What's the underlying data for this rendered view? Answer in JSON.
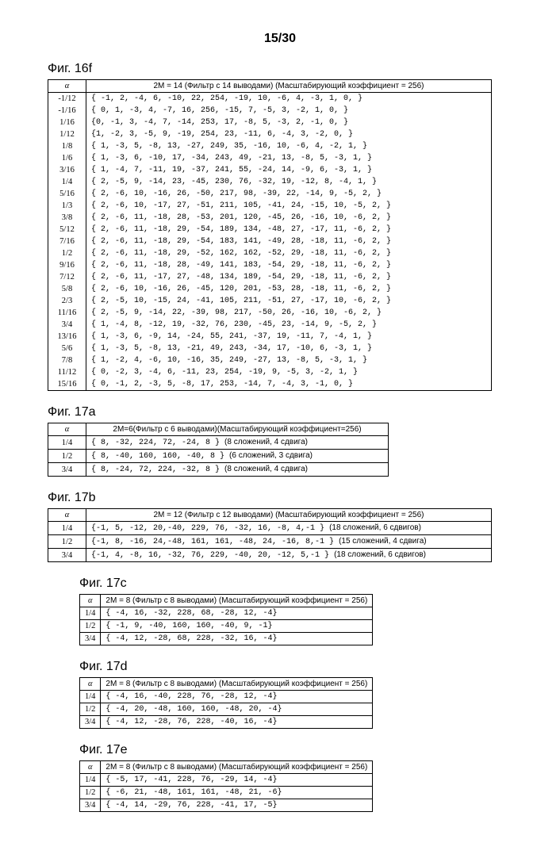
{
  "page_number": "15/30",
  "fig16f": {
    "label": "Фиг. 16f",
    "alpha_header": "α",
    "header": "2М = 14 (Фильтр с 14 выводами) (Масштабирующий коэффициент = 256)",
    "rows": [
      {
        "a": "-1/12",
        "c": "{ -1, 2, -4, 6, -10, 22, 254, -19, 10, -6, 4, -3, 1, 0, }"
      },
      {
        "a": "-1/16",
        "c": "{ 0, 1, -3, 4, -7, 16, 256, -15, 7, -5, 3, -2, 1, 0, }"
      },
      {
        "a": "1/16",
        "c": "{0, -1, 3, -4, 7, -14, 253, 17, -8, 5, -3, 2, -1, 0, }"
      },
      {
        "a": "1/12",
        "c": "{1, -2, 3, -5, 9, -19, 254, 23, -11, 6, -4, 3, -2, 0, }"
      },
      {
        "a": "1/8",
        "c": "{ 1, -3, 5, -8, 13, -27, 249, 35, -16, 10, -6, 4, -2, 1, }"
      },
      {
        "a": "1/6",
        "c": "{ 1, -3, 6, -10, 17, -34, 243, 49, -21, 13, -8, 5, -3, 1, }"
      },
      {
        "a": "3/16",
        "c": "{ 1, -4, 7, -11, 19, -37, 241, 55, -24, 14, -9, 6, -3, 1, }"
      },
      {
        "a": "1/4",
        "c": "{ 2, -5, 9, -14, 23, -45, 230, 76, -32, 19, -12, 8, -4, 1, }"
      },
      {
        "a": "5/16",
        "c": "{ 2, -6, 10, -16, 26, -50, 217, 98, -39, 22, -14, 9, -5, 2, }"
      },
      {
        "a": "1/3",
        "c": "{ 2, -6, 10, -17, 27, -51, 211, 105, -41, 24, -15, 10, -5, 2, }"
      },
      {
        "a": "3/8",
        "c": "{ 2, -6, 11, -18, 28, -53, 201, 120, -45, 26, -16, 10, -6, 2, }"
      },
      {
        "a": "5/12",
        "c": "{ 2, -6, 11, -18, 29, -54, 189, 134, -48, 27, -17, 11, -6, 2, }"
      },
      {
        "a": "7/16",
        "c": "{ 2, -6, 11, -18, 29, -54, 183, 141, -49, 28, -18, 11, -6, 2, }"
      },
      {
        "a": "1/2",
        "c": "{ 2, -6, 11, -18, 29, -52, 162, 162, -52, 29, -18, 11, -6, 2, }"
      },
      {
        "a": "9/16",
        "c": "{ 2, -6, 11, -18, 28, -49, 141, 183, -54, 29, -18, 11, -6, 2, }"
      },
      {
        "a": "7/12",
        "c": "{ 2, -6, 11, -17, 27, -48, 134, 189, -54, 29, -18, 11, -6, 2, }"
      },
      {
        "a": "5/8",
        "c": "{ 2, -6, 10, -16, 26, -45, 120, 201, -53, 28, -18, 11, -6, 2, }"
      },
      {
        "a": "2/3",
        "c": "{ 2, -5, 10, -15, 24, -41, 105, 211, -51, 27, -17, 10, -6, 2, }"
      },
      {
        "a": "11/16",
        "c": "{ 2, -5, 9, -14, 22, -39, 98, 217, -50, 26, -16, 10, -6, 2, }"
      },
      {
        "a": "3/4",
        "c": "{ 1, -4, 8, -12, 19, -32, 76, 230, -45, 23, -14, 9, -5, 2, }"
      },
      {
        "a": "13/16",
        "c": "{ 1, -3, 6, -9, 14, -24, 55, 241, -37, 19, -11, 7, -4, 1, }"
      },
      {
        "a": "5/6",
        "c": "{ 1, -3, 5, -8, 13, -21, 49, 243, -34, 17, -10, 6, -3, 1, }"
      },
      {
        "a": "7/8",
        "c": "{ 1, -2, 4, -6, 10, -16, 35, 249, -27, 13, -8, 5, -3, 1, }"
      },
      {
        "a": "11/12",
        "c": "{ 0, -2, 3, -4, 6, -11, 23, 254, -19, 9, -5, 3, -2, 1, }"
      },
      {
        "a": "15/16",
        "c": "{ 0, -1, 2, -3, 5, -8, 17, 253, -14, 7, -4, 3, -1, 0, }"
      }
    ]
  },
  "fig17a": {
    "label": "Фиг. 17a",
    "alpha_header": "α",
    "header": "2М=6(Фильтр с 6 выводами)(Масштабирующий коэффициент=256)",
    "rows": [
      {
        "a": "1/4",
        "c": "{  8, -32, 224,  72, -24,  8 }",
        "n": "(8 сложений, 4 сдвига)"
      },
      {
        "a": "1/2",
        "c": "{  8, -40, 160, 160, -40,  8 }",
        "n": "(6 сложений, 3 сдвига)"
      },
      {
        "a": "3/4",
        "c": "{  8, -24,  72, 224, -32,  8 }",
        "n": "(8 сложений, 4 сдвига)"
      }
    ]
  },
  "fig17b": {
    "label": "Фиг. 17b",
    "alpha_header": "α",
    "header": "2М = 12 (Фильтр с 12 выводами) (Масштабирующий коэффициент = 256)",
    "rows": [
      {
        "a": "1/4",
        "c": "{-1, 5, -12, 20,-40, 229, 76, -32, 16, -8, 4,-1  }",
        "n": "(18 сложений, 6 сдвигов)"
      },
      {
        "a": "1/2",
        "c": "{-1, 8, -16, 24,-48, 161, 161, -48, 24, -16, 8,-1 }",
        "n": "(15 сложений, 4 сдвига)"
      },
      {
        "a": "3/4",
        "c": "{-1, 4, -8, 16, -32, 76, 229, -40, 20, -12, 5,-1 }",
        "n": "(18 сложений, 6 сдвигов)"
      }
    ]
  },
  "fig17c": {
    "label": "Фиг. 17c",
    "alpha_header": "α",
    "header": "2М = 8 (Фильтр с 8 выводами) (Масштабирующий коэффициент = 256)",
    "rows": [
      {
        "a": "1/4",
        "c": "{ -4, 16,  -32, 228,  68, -28, 12, -4}"
      },
      {
        "a": "1/2",
        "c": "{ -1,  9,  -40, 160, 160, -40,  9, -1}"
      },
      {
        "a": "3/4",
        "c": "{ -4, 12,  -28,  68, 228, -32, 16, -4}"
      }
    ]
  },
  "fig17d": {
    "label": "Фиг. 17d",
    "alpha_header": "α",
    "header": "2М = 8 (Фильтр с 8 выводами) (Масштабирующий коэффициент = 256)",
    "rows": [
      {
        "a": "1/4",
        "c": "{ -4, 16, -40, 228,  76, -28, 12, -4}"
      },
      {
        "a": "1/2",
        "c": "{ -4, 20, -48, 160, 160, -48, 20, -4}"
      },
      {
        "a": "3/4",
        "c": "{ -4, 12, -28,  76, 228, -40, 16, -4}"
      }
    ]
  },
  "fig17e": {
    "label": "Фиг. 17e",
    "alpha_header": "α",
    "header": "2М = 8 (Фильтр с 8 выводами) (Масштабирующий коэффициент = 256)",
    "rows": [
      {
        "a": "1/4",
        "c": "{ -5, 17, -41, 228,  76, -29, 14, -4}"
      },
      {
        "a": "1/2",
        "c": "{ -6, 21, -48, 161, 161, -48, 21, -6}"
      },
      {
        "a": "3/4",
        "c": "{ -4, 14, -29,  76, 228, -41, 17, -5}"
      }
    ]
  }
}
